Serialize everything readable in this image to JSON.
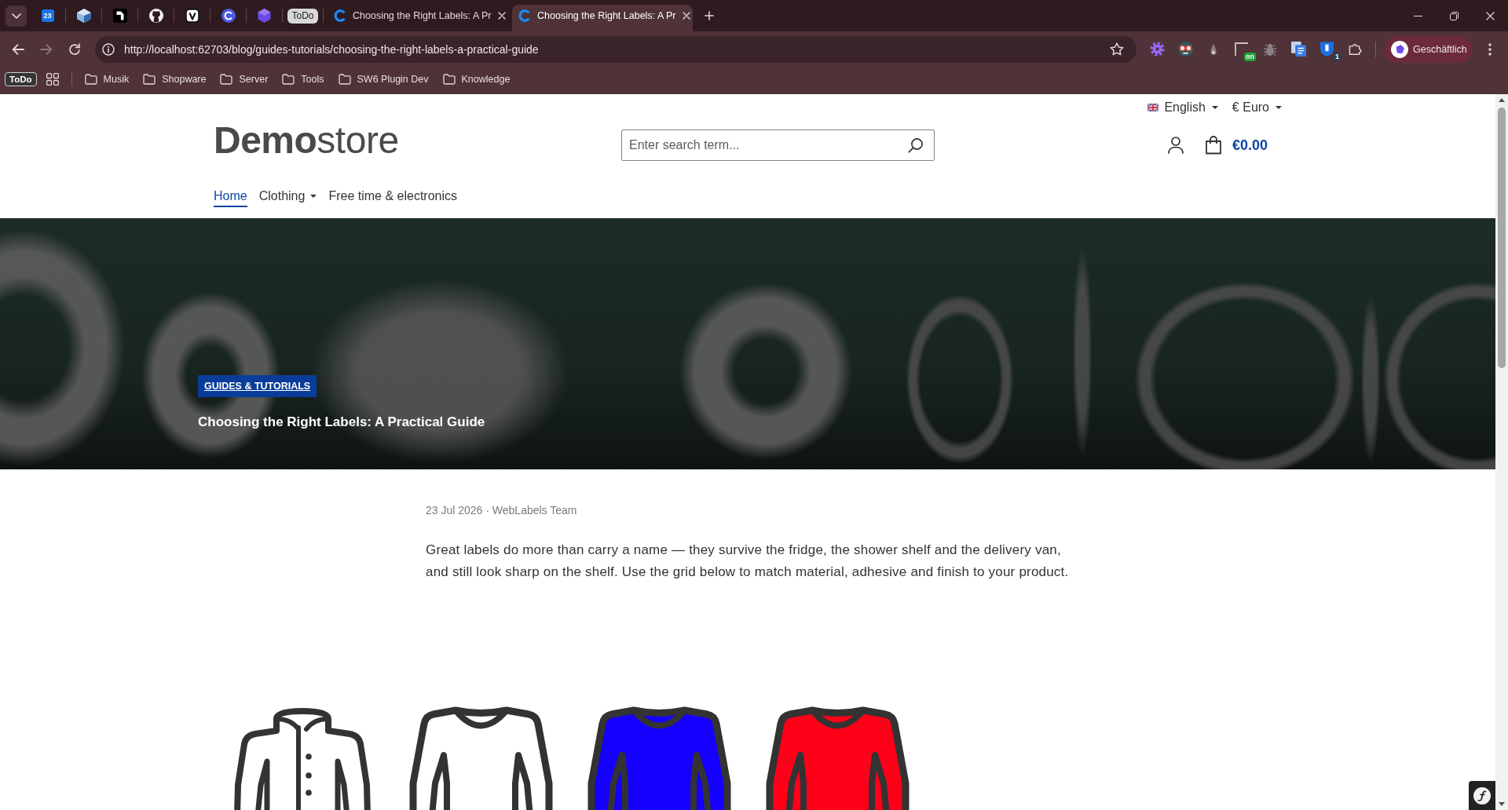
{
  "browser": {
    "pinned_tabs": [
      {
        "kind": "calendar",
        "text": "23"
      },
      {
        "kind": "cube"
      },
      {
        "kind": "square-logo"
      },
      {
        "kind": "cat-logo"
      },
      {
        "kind": "v-logo"
      },
      {
        "kind": "ring-logo"
      },
      {
        "kind": "gem"
      },
      {
        "kind": "label",
        "text": "ToDo"
      }
    ],
    "tabs": [
      {
        "title": "Choosing the Right Labels: A Pr",
        "selected": false
      },
      {
        "title": "Choosing the Right Labels: A Pr",
        "selected": true
      }
    ],
    "url": "http://localhost:62703/blog/guides-tutorials/choosing-the-right-labels-a-practical-guide",
    "extensions": [
      {
        "kind": "gear"
      },
      {
        "kind": "glasses"
      },
      {
        "kind": "flame"
      },
      {
        "kind": "corner",
        "badge": "on"
      },
      {
        "kind": "bug"
      },
      {
        "kind": "documents"
      },
      {
        "kind": "shield",
        "badge": "1"
      },
      {
        "kind": "puzzle"
      }
    ],
    "profile": "Geschäftlich",
    "bookmarks": [
      {
        "kind": "label",
        "title": "ToDo"
      },
      {
        "kind": "apps"
      },
      {
        "kind": "folder",
        "title": "Musik"
      },
      {
        "kind": "folder",
        "title": "Shopware"
      },
      {
        "kind": "folder",
        "title": "Server"
      },
      {
        "kind": "folder",
        "title": "Tools"
      },
      {
        "kind": "folder",
        "title": "SW6 Plugin Dev"
      },
      {
        "kind": "folder",
        "title": "Knowledge"
      }
    ]
  },
  "store": {
    "language": "English",
    "currency": "€ Euro",
    "logo": "**Demo**store",
    "search": {
      "placeholder": "Enter search term..."
    },
    "cart_total": "€0.00",
    "nav": [
      {
        "label": "Home",
        "selected": true,
        "dropdown": false
      },
      {
        "label": "Clothing",
        "selected": false,
        "dropdown": true
      },
      {
        "label": "Free time & electronics",
        "selected": false,
        "dropdown": false
      }
    ]
  },
  "hero": {
    "category": "GUIDES & TUTORIALS",
    "title": "Choosing the Right Labels: A Practical Guide"
  },
  "article": {
    "meta": "23 Jul 2026 · WebLabels Team",
    "intro": "Great labels do more than carry a name — they survive the fridge, the shower shelf and the delivery van, and still look sharp on the shelf. Use the grid below to match material, adhesive and finish to your product."
  },
  "product_images": [
    {
      "kind": "shirt",
      "color": "#ffffff"
    },
    {
      "kind": "sweater",
      "color": "#ffffff"
    },
    {
      "kind": "sweater",
      "color": "#1500ff"
    },
    {
      "kind": "sweater",
      "color": "#ff0019"
    }
  ]
}
